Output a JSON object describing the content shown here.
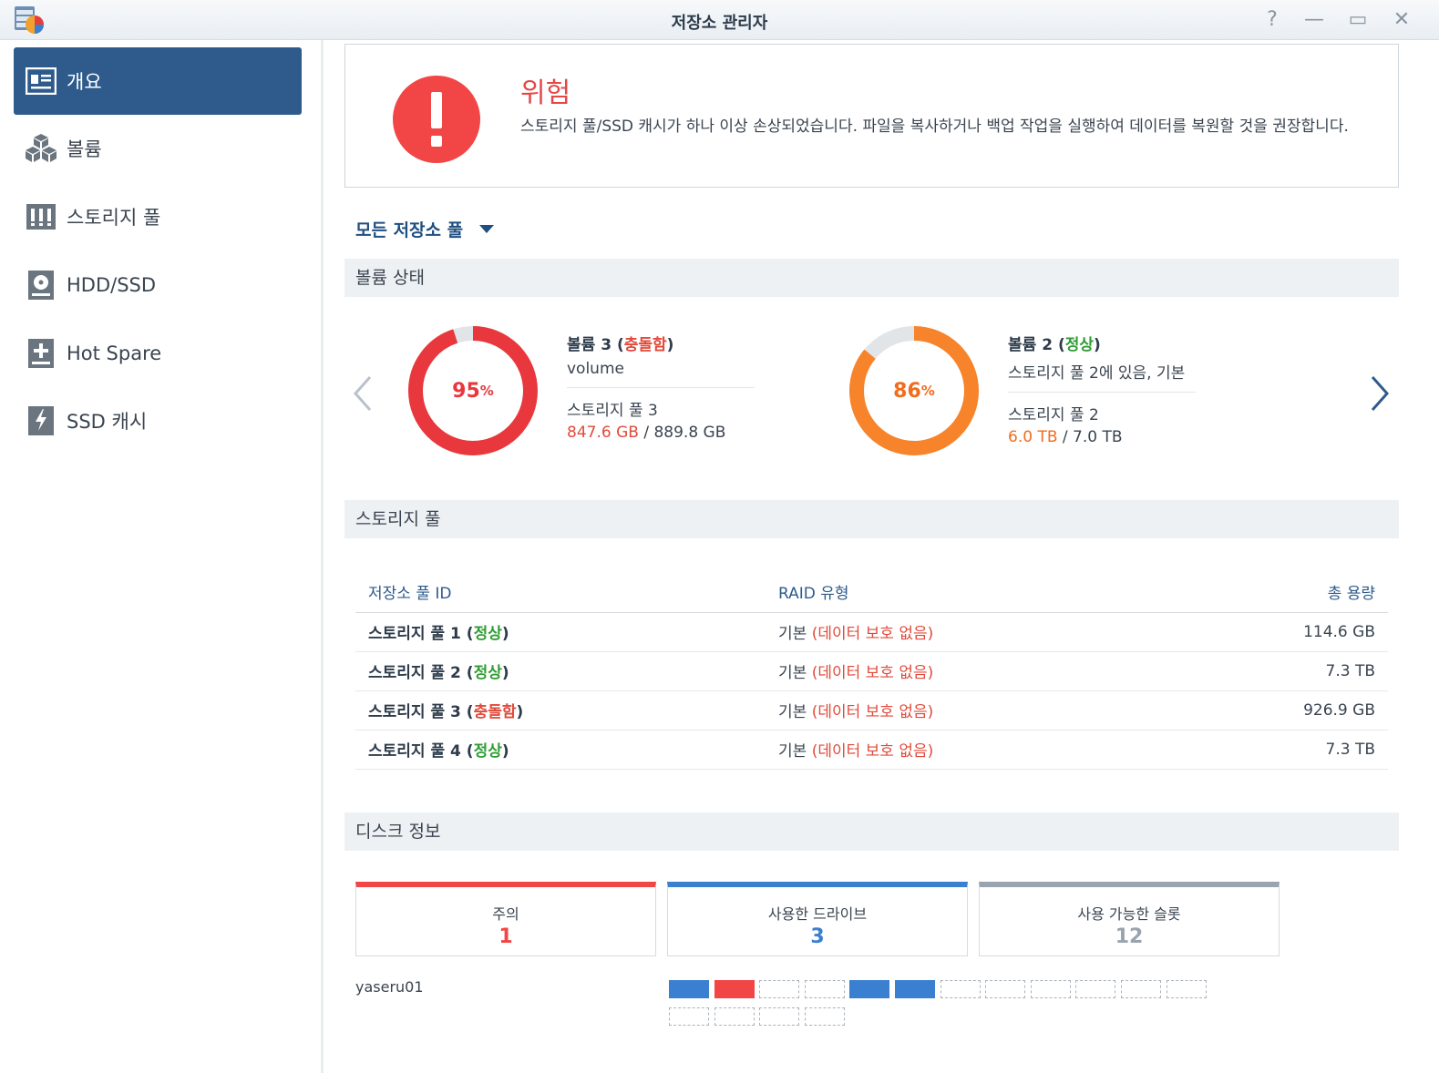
{
  "window": {
    "title": "저장소 관리자",
    "help": "?",
    "minimize": "—",
    "maximize": "▭",
    "close": "✕"
  },
  "sidebar": {
    "items": [
      {
        "label": "개요",
        "icon": "overview-icon",
        "active": true
      },
      {
        "label": "볼륨",
        "icon": "volume-cubes-icon",
        "active": false
      },
      {
        "label": "스토리지 풀",
        "icon": "storage-pool-icon",
        "active": false
      },
      {
        "label": "HDD/SSD",
        "icon": "hdd-icon",
        "active": false
      },
      {
        "label": "Hot Spare",
        "icon": "hot-spare-icon",
        "active": false
      },
      {
        "label": "SSD 캐시",
        "icon": "ssd-cache-icon",
        "active": false
      }
    ]
  },
  "alert": {
    "title": "위험",
    "message": "스토리지 풀/SSD 캐시가 하나 이상 손상되었습니다. 파일을 복사하거나 백업 작업을 실행하여 데이터를 복원할 것을 권장합니다."
  },
  "pool_filter": {
    "label": "모든 저장소 풀"
  },
  "volume_status": {
    "header": "볼륨 상태",
    "volumes": [
      {
        "name": "볼륨 3",
        "status": "충돌함",
        "status_color": "#e14a3a",
        "subtitle": "volume",
        "pool": "스토리지 풀 3",
        "used": "847.6 GB",
        "total": "889.8 GB",
        "percent": 95,
        "percent_suffix": "%",
        "ring_color": "#e8383d",
        "text_color": "#e8383d"
      },
      {
        "name": "볼륨 2",
        "status": "정상",
        "status_color": "#2f9d34",
        "subtitle": "스토리지 풀 2에 있음, 기본",
        "pool": "스토리지 풀 2",
        "used": "6.0 TB",
        "total": "7.0 TB",
        "percent": 86,
        "percent_suffix": "%",
        "ring_color": "#f7832a",
        "text_color": "#f26c1e"
      }
    ]
  },
  "storage_pools": {
    "header": "스토리지 풀",
    "columns": [
      "저장소 풀 ID",
      "RAID 유형",
      "총 용량"
    ],
    "rows": [
      {
        "name": "스토리지 풀 1",
        "status": "정상",
        "raid": "기본",
        "raid_note": "(데이터 보호 없음)",
        "capacity": "114.6 GB"
      },
      {
        "name": "스토리지 풀 2",
        "status": "정상",
        "raid": "기본",
        "raid_note": "(데이터 보호 없음)",
        "capacity": "7.3 TB"
      },
      {
        "name": "스토리지 풀 3",
        "status": "충돌함",
        "raid": "기본",
        "raid_note": "(데이터 보호 없음)",
        "capacity": "926.9 GB"
      },
      {
        "name": "스토리지 풀 4",
        "status": "정상",
        "raid": "기본",
        "raid_note": "(데이터 보호 없음)",
        "capacity": "7.3 TB"
      }
    ]
  },
  "disk_info": {
    "header": "디스크 정보",
    "cards": [
      {
        "label": "주의",
        "value": "1",
        "color": "#f24646"
      },
      {
        "label": "사용한 드라이브",
        "value": "3",
        "color": "#3a7fd0"
      },
      {
        "label": "사용 가능한 슬롯",
        "value": "12",
        "color": "#9aa4ae"
      }
    ],
    "server": "yaseru01",
    "slots": [
      "used",
      "warn",
      "empty",
      "empty",
      "used",
      "used",
      "empty",
      "empty",
      "empty",
      "empty",
      "empty",
      "empty",
      "empty",
      "empty",
      "empty",
      "empty"
    ]
  },
  "colors": {
    "accent": "#2e5b8c",
    "danger": "#f24646",
    "ok": "#2f9d34"
  }
}
